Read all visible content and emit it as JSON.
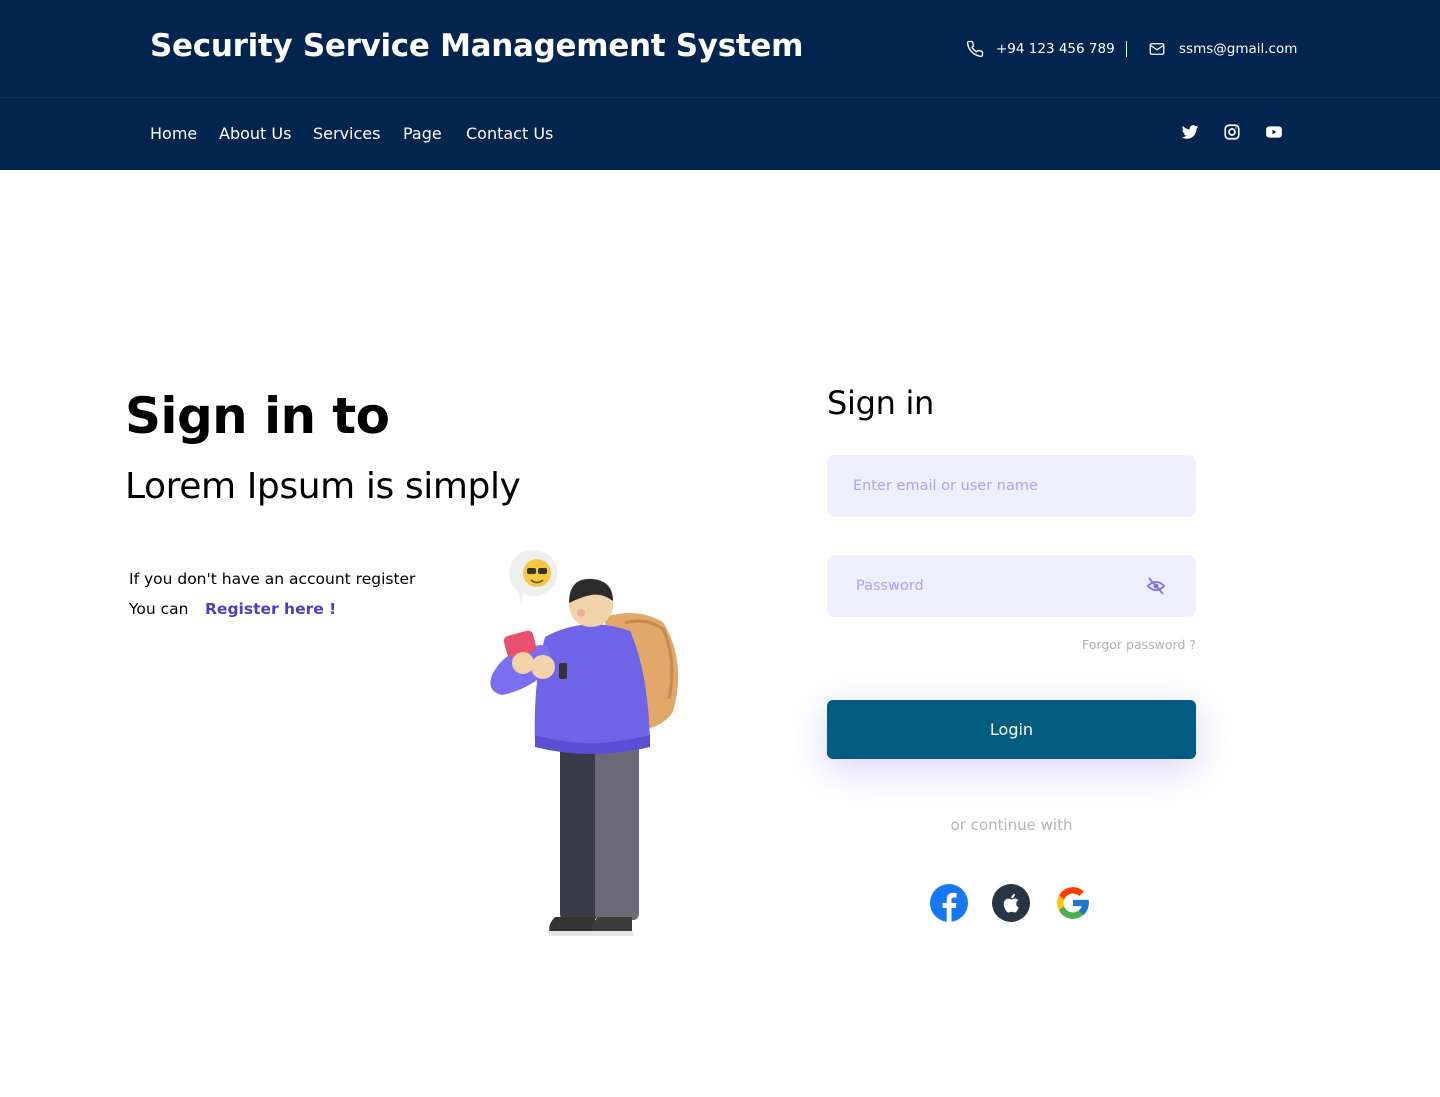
{
  "header": {
    "title": "Security Service Management System",
    "phone": "+94 123 456 789",
    "email": "ssms@gmail.com",
    "phone_icon": "phone-icon",
    "email_icon": "mail-icon"
  },
  "nav": {
    "items": [
      {
        "label": "Home"
      },
      {
        "label": "About Us"
      },
      {
        "label": "Services"
      },
      {
        "label": "Page"
      },
      {
        "label": "Contact Us"
      }
    ],
    "social": [
      "twitter-icon",
      "instagram-icon",
      "youtube-icon"
    ]
  },
  "hero": {
    "title": "Sign in to",
    "subtitle": "Lorem Ipsum is simply",
    "register_text": "If you don't have an account register",
    "register_prefix": "You can",
    "register_link": "Register here !"
  },
  "signin": {
    "title": "Sign in",
    "email_placeholder": "Enter email or user name",
    "password_placeholder": "Password",
    "forgot": "Forgor password ?",
    "login": "Login",
    "continue_with": "or continue with",
    "providers": [
      "facebook-icon",
      "apple-icon",
      "google-icon"
    ]
  },
  "colors": {
    "header_bg": "#01254f",
    "input_bg": "#f0efff",
    "placeholder": "#a7a3ff",
    "login_bg": "#025c82",
    "link": "#4b3fc4"
  }
}
